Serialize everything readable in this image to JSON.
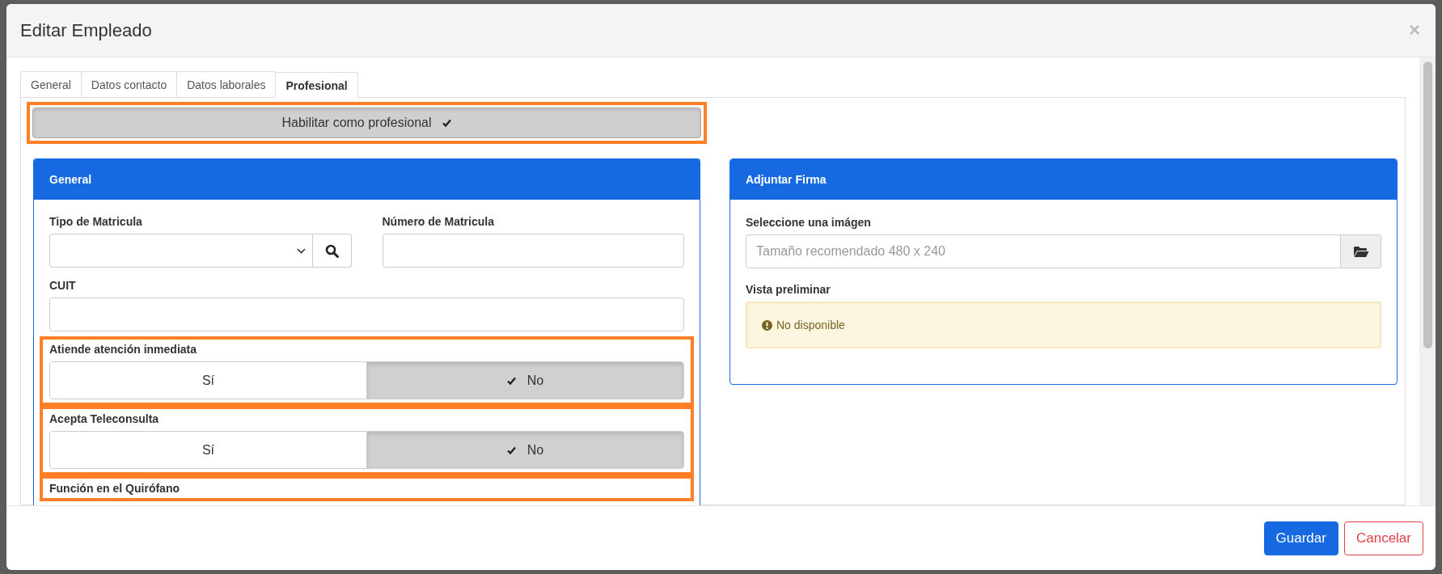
{
  "window": {
    "title": "Editar Empleado",
    "close": "×"
  },
  "tabs": [
    {
      "label": "General",
      "selected": false
    },
    {
      "label": "Datos contacto",
      "selected": false
    },
    {
      "label": "Datos laborales",
      "selected": false
    },
    {
      "label": "Profesional",
      "selected": true
    }
  ],
  "enable_button": {
    "label": "Habilitar como profesional",
    "checked": true,
    "highlighted": true
  },
  "general_panel": {
    "title": "General",
    "rows": [
      {
        "fields": [
          {
            "kind": "select-search",
            "label": "Tipo de Matricula",
            "highlighted": false
          },
          {
            "kind": "text",
            "label": "Número de Matricula",
            "highlighted": false
          }
        ]
      },
      {
        "fields": [
          {
            "kind": "text",
            "label": "CUIT",
            "highlighted": false
          }
        ]
      },
      {
        "fields": [
          {
            "kind": "toggle",
            "label": "Atiende atención inmediata",
            "highlighted": true,
            "options": [
              {
                "label": "Sí",
                "selected": false
              },
              {
                "label": "No",
                "selected": true
              }
            ]
          }
        ]
      },
      {
        "fields": [
          {
            "kind": "toggle",
            "label": "Acepta Teleconsulta",
            "highlighted": true,
            "options": [
              {
                "label": "Sí",
                "selected": false
              },
              {
                "label": "No",
                "selected": true
              }
            ]
          }
        ]
      },
      {
        "fields": [
          {
            "kind": "label",
            "label": "Función en el Quirófano",
            "highlighted": true
          }
        ]
      }
    ]
  },
  "signature_panel": {
    "title": "Adjuntar Firma",
    "file_field": {
      "label": "Seleccione una imágen",
      "placeholder": "Tamaño recomendado 480 x 240"
    },
    "preview": {
      "label": "Vista preliminar",
      "message": "No disponible"
    }
  },
  "footer_buttons": [
    {
      "label": "Guardar",
      "kind": "primary"
    },
    {
      "label": "Cancelar",
      "kind": "danger"
    }
  ]
}
